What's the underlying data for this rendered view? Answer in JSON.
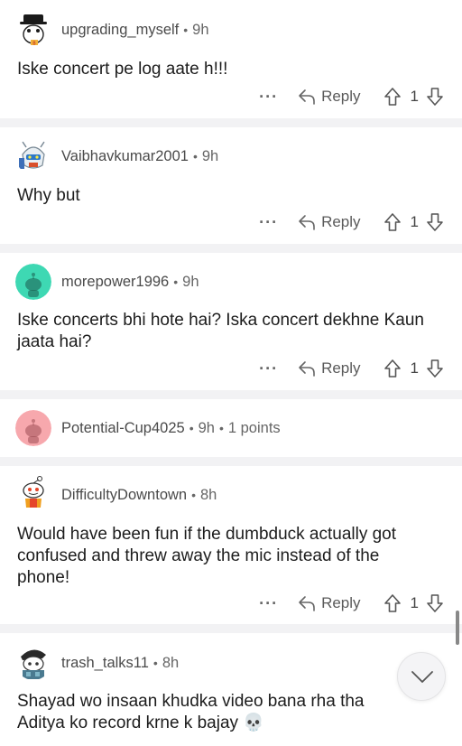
{
  "comments": [
    {
      "username": "upgrading_myself",
      "time": "9h",
      "text": "Iske concert pe log aate h!!!",
      "reply_label": "Reply",
      "votes": "1",
      "avatar": "snoo-black-hat-avatar"
    },
    {
      "username": "Vaibhavkumar2001",
      "time": "9h",
      "text": "Why but",
      "reply_label": "Reply",
      "votes": "1",
      "avatar": "robot-avatar"
    },
    {
      "username": "morepower1996",
      "time": "9h",
      "text": "Iske concerts bhi hote hai? Iska concert dekhne Kaun jaata hai?",
      "reply_label": "Reply",
      "votes": "1",
      "avatar": "default-teal-snoo-avatar"
    },
    {
      "username": "Potential-Cup4025",
      "time": "9h",
      "extra": "1 points",
      "avatar": "default-pink-snoo-avatar"
    },
    {
      "username": "DifficultyDowntown",
      "time": "8h",
      "text": "Would have been fun if the dumbduck actually got confused and threw away the mic instead of the phone!",
      "reply_label": "Reply",
      "votes": "1",
      "avatar": "snoo-orange-avatar"
    },
    {
      "username": "trash_talks11",
      "time": "8h",
      "text": "Shayad wo insaan khudka video bana rha tha Aditya ko record krne k bajay 💀",
      "avatar": "snoo-cap-avatar"
    }
  ],
  "icons": {
    "more": "more-options-icon",
    "reply": "reply-arrow-icon",
    "upvote": "upvote-arrow-icon",
    "downvote": "downvote-arrow-icon",
    "scroll": "chevron-down-icon"
  },
  "colors": {
    "background": "#f2f2f4",
    "card": "#ffffff",
    "meta_text": "#555555",
    "teal_avatar": "#3ed8b3",
    "pink_avatar": "#f7a8ad"
  }
}
